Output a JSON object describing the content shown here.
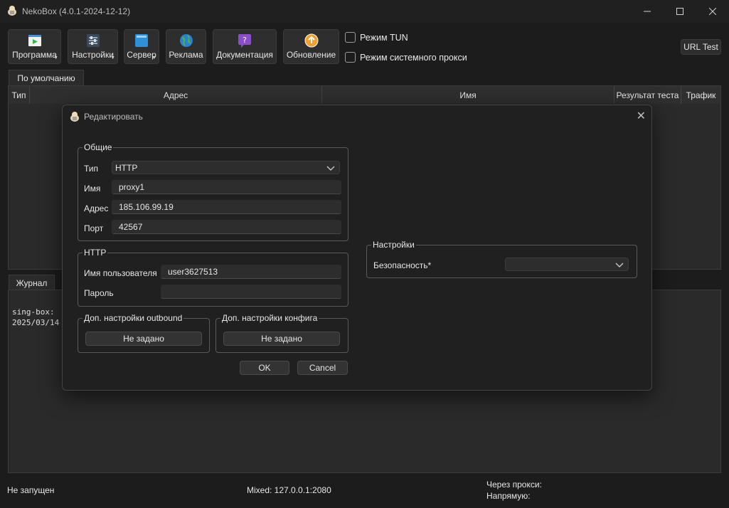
{
  "window": {
    "title": "NekoBox (4.0.1-2024-12-12)",
    "icons": [
      "app-icon",
      "minimize-icon",
      "maximize-icon",
      "close-icon"
    ]
  },
  "toolbar": {
    "program": "Программа",
    "settings": "Настройки",
    "server": "Сервер",
    "ads": "Реклама",
    "docs": "Документация",
    "update": "Обновление",
    "tun_mode": "Режим TUN",
    "system_proxy_mode": "Режим системного прокси",
    "url_test": "URL Test"
  },
  "groups_tab": "По умолчанию",
  "table_columns": [
    "Тип",
    "Адрес",
    "Имя",
    "Результат теста",
    "Трафик"
  ],
  "log": {
    "tab": "Журнал",
    "lines": [
      "sing-box:",
      "2025/03/14"
    ]
  },
  "status": {
    "state": "Не запущен",
    "mixed": "Mixed: 127.0.0.1:2080",
    "via_proxy": "Через прокси:",
    "direct": "Напрямую:"
  },
  "dialog": {
    "title": "Редактировать",
    "general": {
      "legend": "Общие",
      "type_label": "Тип",
      "type_value": "HTTP",
      "name_label": "Имя",
      "name_value": "proxy1",
      "address_label": "Адрес",
      "address_value": "185.106.99.19",
      "port_label": "Порт",
      "port_value": "42567"
    },
    "http": {
      "legend": "HTTP",
      "username_label": "Имя пользователя",
      "username_value": "user3627513",
      "password_label": "Пароль",
      "password_value": ""
    },
    "outbound": {
      "legend": "Доп. настройки outbound",
      "button": "Не задано"
    },
    "config": {
      "legend": "Доп. настройки конфига",
      "button": "Не задано"
    },
    "settings": {
      "legend": "Настройки",
      "security_label": "Безопасность*",
      "security_value": ""
    },
    "ok": "OK",
    "cancel": "Cancel"
  },
  "colors": {
    "background": "#1c1c1c",
    "panel": "#2a2a2a",
    "dialog": "#202020",
    "field": "#2d2d2d"
  }
}
